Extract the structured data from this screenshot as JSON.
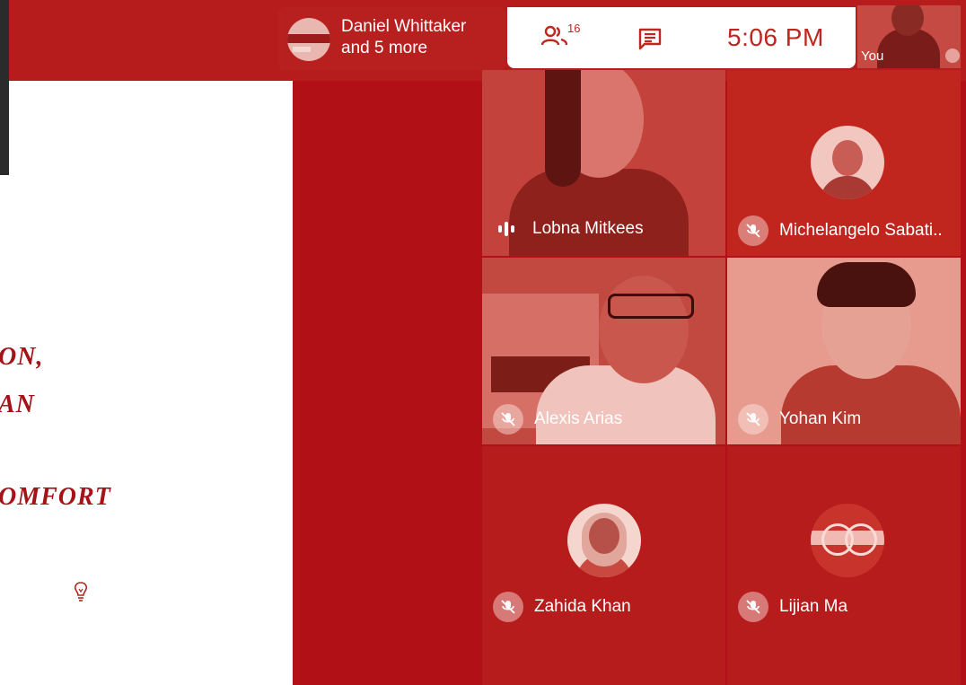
{
  "slide": {
    "lines": [
      "ON,",
      "AN",
      "OMFORT"
    ]
  },
  "meeting": {
    "organizer": "Daniel Whittaker",
    "others": "and 5 more"
  },
  "toolbar": {
    "participant_count": "16",
    "time": "5:06 PM"
  },
  "self_view": {
    "label": "You"
  },
  "participants": [
    {
      "name": "Lobna Mitkees",
      "muted": false
    },
    {
      "name": "Michelangelo Sabati..",
      "muted": true
    },
    {
      "name": "Alexis Arias",
      "muted": true
    },
    {
      "name": "Yohan Kim",
      "muted": true
    },
    {
      "name": "Zahida Khan",
      "muted": true
    },
    {
      "name": "Lijian Ma",
      "muted": true
    }
  ],
  "colors": {
    "background": "#b11016",
    "accent": "#c0251f",
    "panel": "#ffffff"
  },
  "icons": [
    "people-icon",
    "chat-icon",
    "mic-off-icon",
    "audio-level-icon",
    "lightbulb-icon"
  ]
}
